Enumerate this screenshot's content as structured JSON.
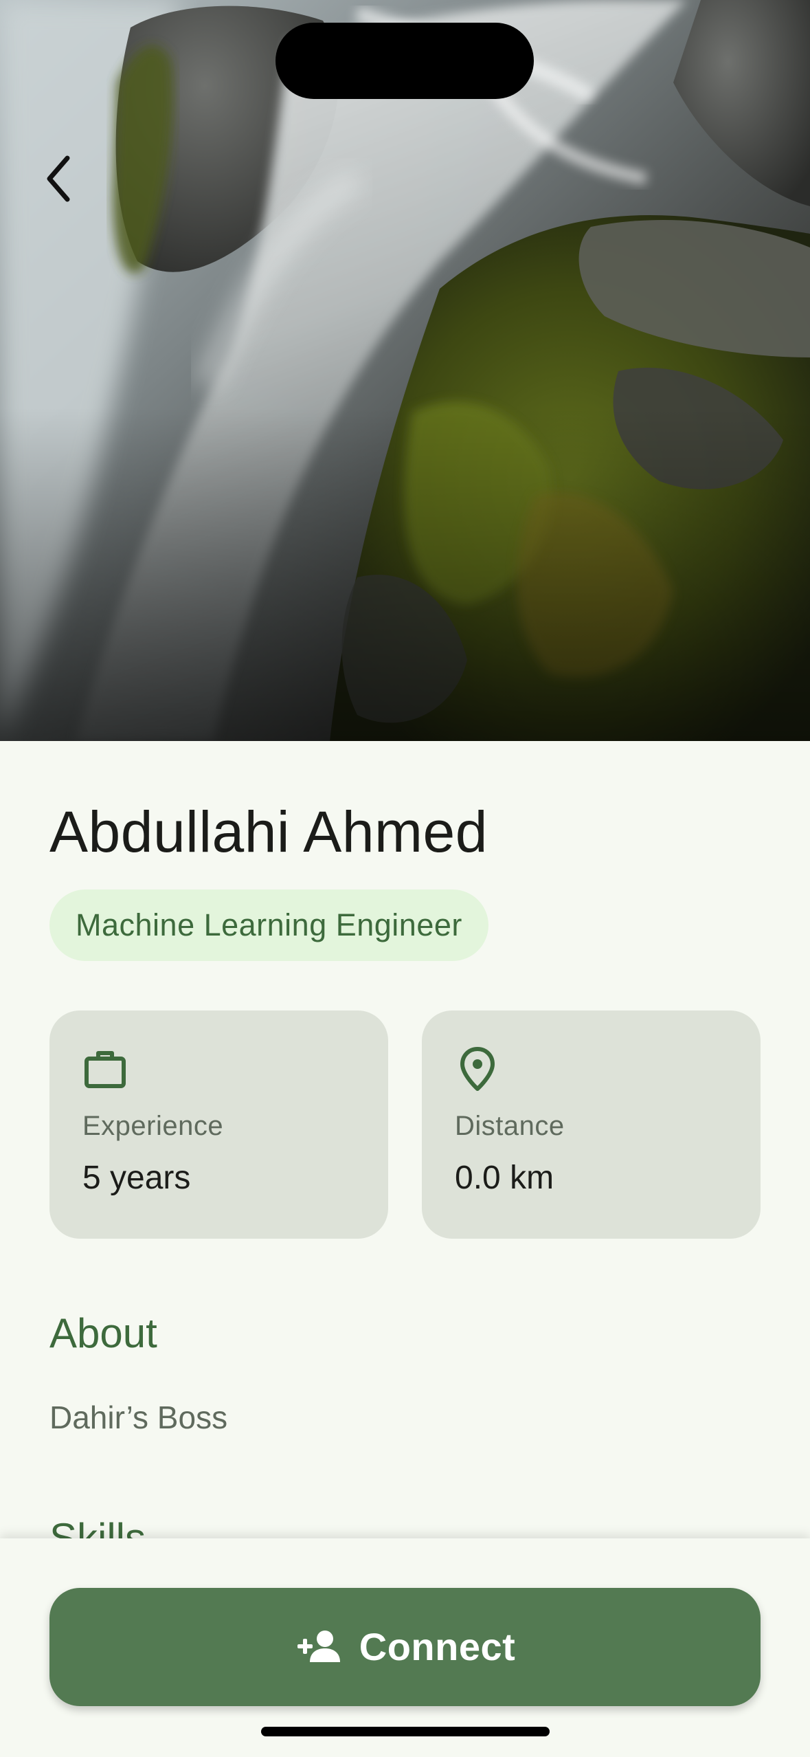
{
  "profile": {
    "name": "Abdullahi Ahmed",
    "role": "Machine Learning Engineer"
  },
  "stats": {
    "experience": {
      "label": "Experience",
      "value": "5 years",
      "icon": "briefcase-icon"
    },
    "distance": {
      "label": "Distance",
      "value": "0.0 km",
      "icon": "location-pin-icon"
    }
  },
  "about": {
    "title": "About",
    "text": "Dahir’s Boss"
  },
  "skills": {
    "title": "Skills"
  },
  "actions": {
    "connect_label": "Connect",
    "connect_icon": "person-add-icon",
    "back_icon": "chevron-left-icon"
  },
  "colors": {
    "accent": "#537a52",
    "accent_text": "#3d6a3c",
    "chip_bg": "#e3f5dc",
    "card_bg": "#dde2d8",
    "background": "#f6f9f2"
  }
}
